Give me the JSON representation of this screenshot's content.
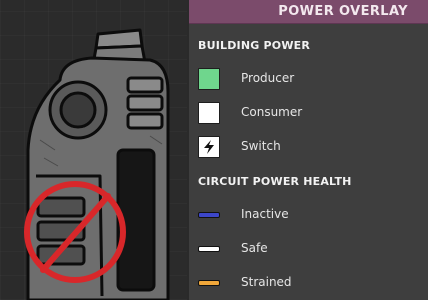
{
  "overlay": {
    "title": "POWER OVERLAY",
    "sections": [
      {
        "title": "BUILDING POWER",
        "items": [
          {
            "label": "Producer",
            "swatch": "box",
            "color": "#6fd68d",
            "icon": "producer-swatch-icon"
          },
          {
            "label": "Consumer",
            "swatch": "box",
            "color": "#ffffff",
            "icon": "consumer-swatch-icon"
          },
          {
            "label": "Switch",
            "swatch": "box",
            "color": "#ffffff",
            "icon": "lightning-bolt-icon"
          }
        ]
      },
      {
        "title": "CIRCUIT POWER HEALTH",
        "items": [
          {
            "label": "Inactive",
            "swatch": "line",
            "color": "#3c46c8"
          },
          {
            "label": "Safe",
            "swatch": "line",
            "color": "#ffffff"
          },
          {
            "label": "Strained",
            "swatch": "line",
            "color": "#f0a73a"
          }
        ]
      }
    ]
  },
  "colors": {
    "header_bg": "#7b4b6b",
    "panel_bg": "#3e3e3e",
    "no_symbol": "#d8272a"
  }
}
